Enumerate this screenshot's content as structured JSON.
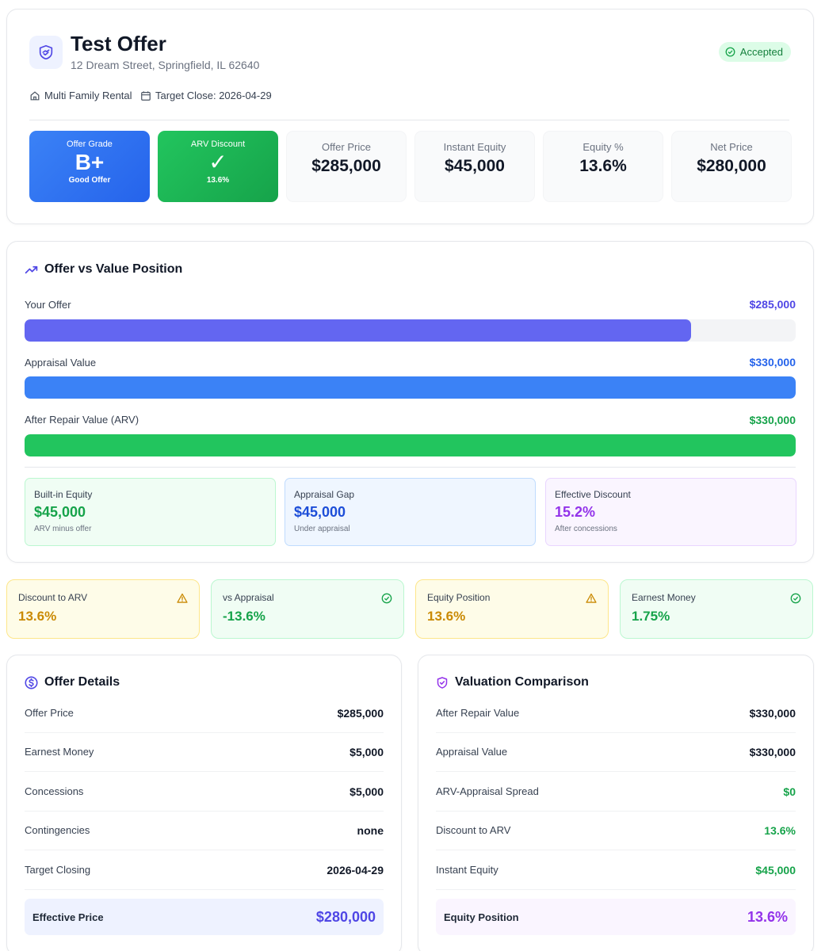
{
  "header": {
    "title": "Test Offer",
    "address": "12 Dream Street, Springfield, IL 62640",
    "status": "Accepted",
    "property_type": "Multi Family Rental",
    "target_close": "Target Close: 2026-04-29"
  },
  "stats": {
    "grade_label": "Offer Grade",
    "grade": "B+",
    "grade_sub": "Good Offer",
    "arv_label": "ARV Discount",
    "arv_check": "✓",
    "arv_sub": "13.6%",
    "offer_price_label": "Offer Price",
    "offer_price": "$285,000",
    "instant_equity_label": "Instant Equity",
    "instant_equity": "$45,000",
    "equity_pct_label": "Equity %",
    "equity_pct": "13.6%",
    "net_price_label": "Net Price",
    "net_price": "$280,000"
  },
  "position": {
    "title": "Offer vs Value Position",
    "bars": [
      {
        "label": "Your Offer",
        "value": "$285,000",
        "fill_fraction": 0.864,
        "color": "#6366f1"
      },
      {
        "label": "Appraisal Value",
        "value": "$330,000",
        "fill_fraction": 1.0,
        "color": "#3b82f6"
      },
      {
        "label": "After Repair Value (ARV)",
        "value": "$330,000",
        "fill_fraction": 1.0,
        "color": "#22c55e"
      }
    ],
    "mini": [
      {
        "label": "Built-in Equity",
        "value": "$45,000",
        "sub": "ARV minus offer"
      },
      {
        "label": "Appraisal Gap",
        "value": "$45,000",
        "sub": "Under appraisal"
      },
      {
        "label": "Effective Discount",
        "value": "15.2%",
        "sub": "After concessions"
      }
    ]
  },
  "metrics": [
    {
      "label": "Discount to ARV",
      "value": "13.6%",
      "icon": "warning-icon"
    },
    {
      "label": "vs Appraisal",
      "value": "-13.6%",
      "icon": "check-circle-icon"
    },
    {
      "label": "Equity Position",
      "value": "13.6%",
      "icon": "warning-icon"
    },
    {
      "label": "Earnest Money",
      "value": "1.75%",
      "icon": "check-circle-icon"
    }
  ],
  "offer_details": {
    "title": "Offer Details",
    "rows": [
      {
        "label": "Offer Price",
        "value": "$285,000"
      },
      {
        "label": "Earnest Money",
        "value": "$5,000"
      },
      {
        "label": "Concessions",
        "value": "$5,000"
      },
      {
        "label": "Contingencies",
        "value": "none"
      },
      {
        "label": "Target Closing",
        "value": "2026-04-29"
      }
    ],
    "total_label": "Effective Price",
    "total_value": "$280,000"
  },
  "valuation": {
    "title": "Valuation Comparison",
    "rows": [
      {
        "label": "After Repair Value",
        "value": "$330,000"
      },
      {
        "label": "Appraisal Value",
        "value": "$330,000"
      },
      {
        "label": "ARV-Appraisal Spread",
        "value": "$0"
      },
      {
        "label": "Discount to ARV",
        "value": "13.6%"
      },
      {
        "label": "Instant Equity",
        "value": "$45,000"
      }
    ],
    "total_label": "Equity Position",
    "total_value": "13.6%"
  },
  "colors": {
    "indigo": "#4f46e5",
    "blue": "#2563eb",
    "green": "#16a34a",
    "purple": "#9333ea",
    "amber": "#ca8a04"
  }
}
